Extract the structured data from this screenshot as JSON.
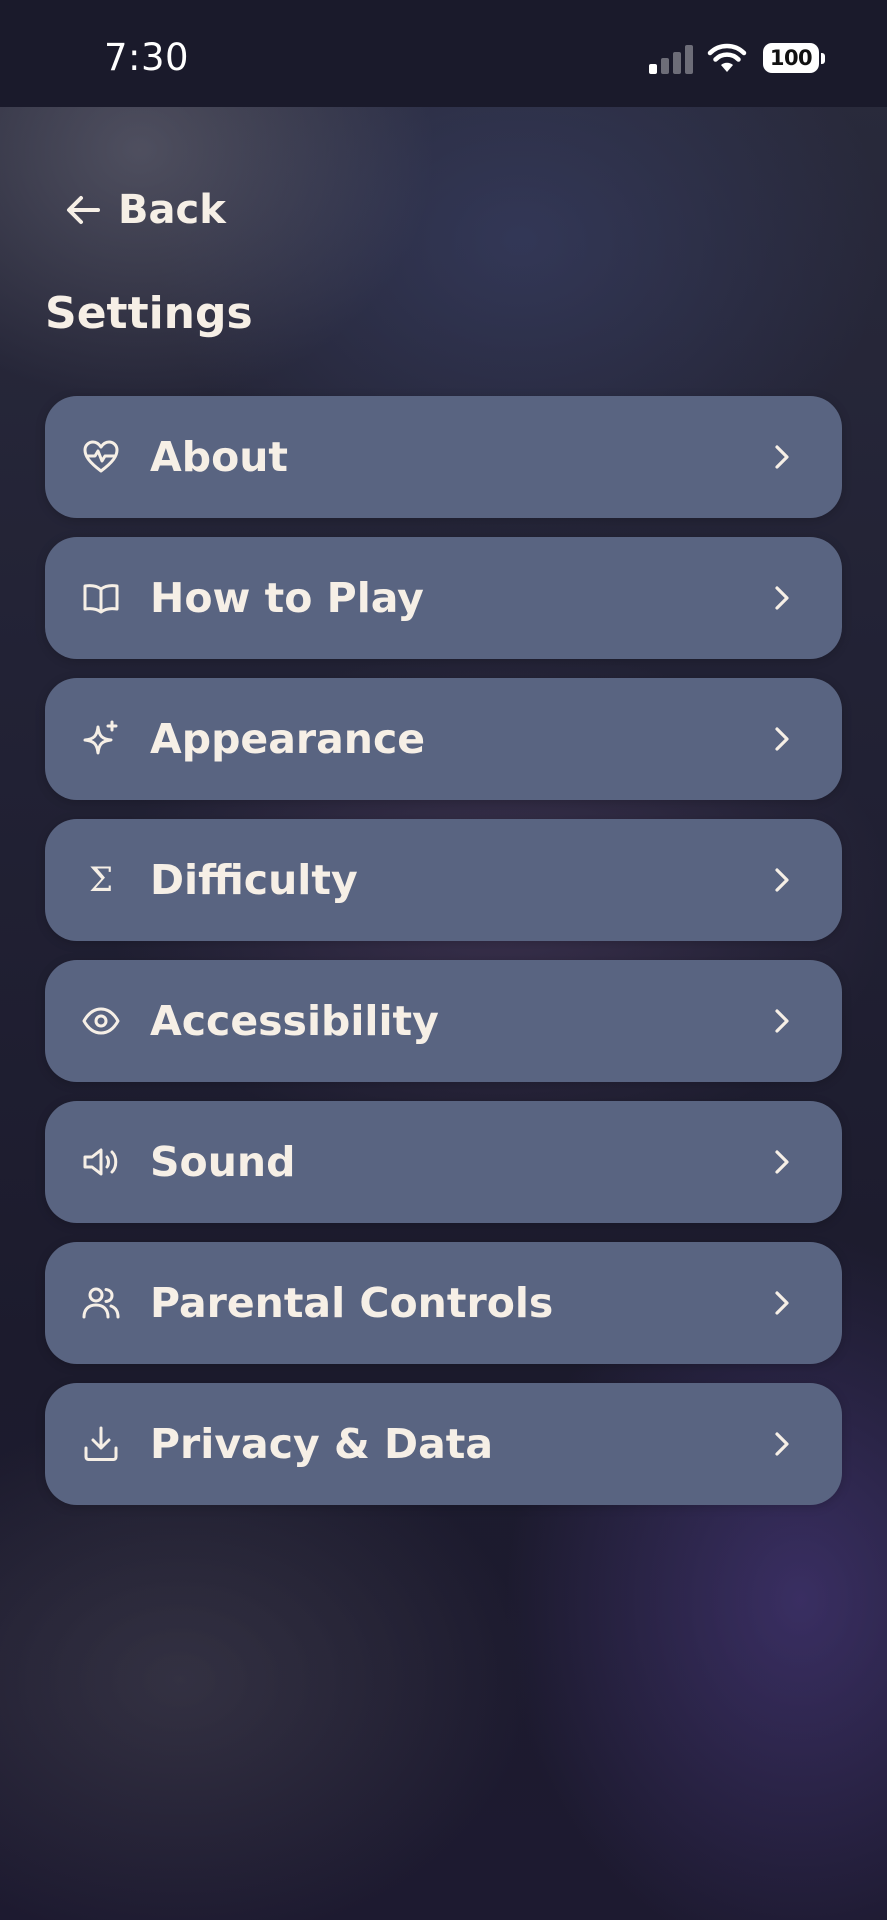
{
  "status_bar": {
    "time": "7:30",
    "battery": "100",
    "signal_icon": "cellular-signal-icon",
    "wifi_icon": "wifi-icon",
    "battery_icon": "battery-icon"
  },
  "nav": {
    "back_label": "Back",
    "back_icon": "arrow-left-icon"
  },
  "page": {
    "title": "Settings"
  },
  "menu": {
    "items": [
      {
        "label": "About",
        "icon": "heart-pulse-icon"
      },
      {
        "label": "How to Play",
        "icon": "book-open-icon"
      },
      {
        "label": "Appearance",
        "icon": "sparkles-icon"
      },
      {
        "label": "Difficulty",
        "icon": "sigma-icon",
        "glyph": "Σ"
      },
      {
        "label": "Accessibility",
        "icon": "eye-icon"
      },
      {
        "label": "Sound",
        "icon": "speaker-icon"
      },
      {
        "label": "Parental Controls",
        "icon": "users-icon"
      },
      {
        "label": "Privacy & Data",
        "icon": "download-icon"
      }
    ]
  },
  "colors": {
    "card": "#596481",
    "text": "#f6efe6",
    "status_bar_bg": "#1a1a2b"
  }
}
